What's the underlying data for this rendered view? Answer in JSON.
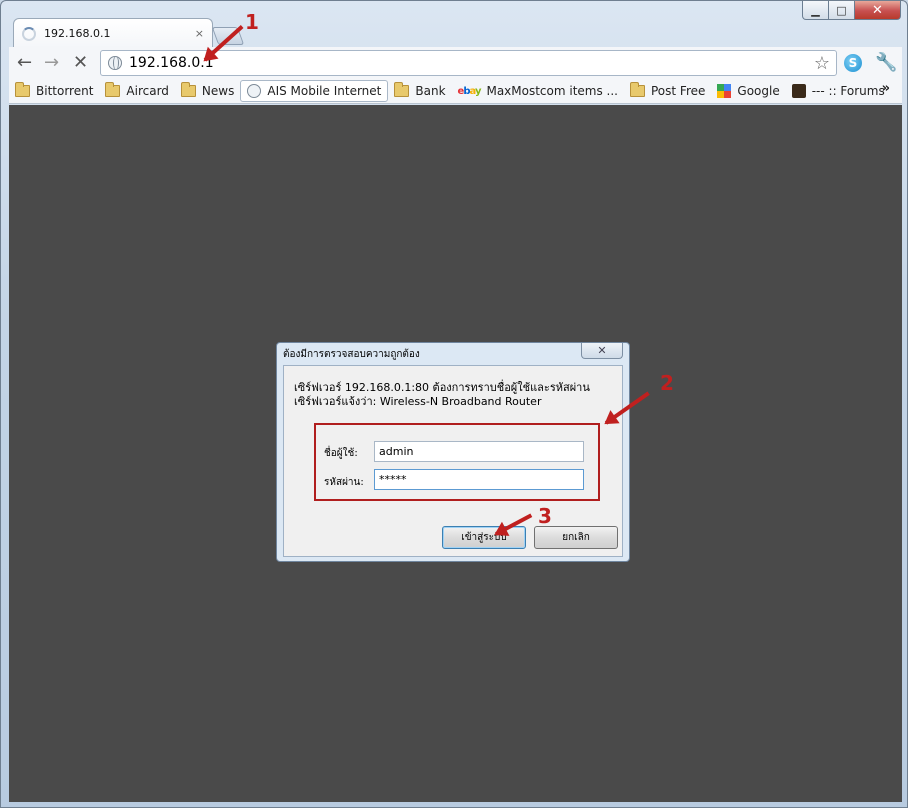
{
  "tab": {
    "title": "192.168.0.1",
    "close_glyph": "×"
  },
  "toolbar": {
    "url": "192.168.0.1"
  },
  "bookmarks": [
    {
      "label": "Bittorrent",
      "icon": "folder"
    },
    {
      "label": "Aircard",
      "icon": "folder"
    },
    {
      "label": "News",
      "icon": "folder"
    },
    {
      "label": "AIS Mobile Internet",
      "icon": "globe"
    },
    {
      "label": "Bank",
      "icon": "folder"
    },
    {
      "label": "MaxMostcom items ...",
      "icon": "ebay"
    },
    {
      "label": "Post Free",
      "icon": "folder"
    },
    {
      "label": "Google",
      "icon": "google"
    },
    {
      "label": "--- :: Forums",
      "icon": "forum"
    }
  ],
  "dialog": {
    "title": "ต้องมีการตรวจสอบความถูกต้อง",
    "message_line1": "เซิร์ฟเวอร์ 192.168.0.1:80 ต้องการทราบชื่อผู้ใช้และรหัสผ่าน",
    "message_line2": "เซิร์ฟเวอร์แจ้งว่า: Wireless-N Broadband Router",
    "username_label": "ชื่อผู้ใช้:",
    "username_value": "admin",
    "password_label": "รหัสผ่าน:",
    "password_value": "*****",
    "login_button": "เข้าสู่ระบบ",
    "cancel_button": "ยกเลิก"
  },
  "annotations": {
    "step1": "1",
    "step2": "2",
    "step3": "3"
  },
  "colors": {
    "annotation": "#c0201f",
    "content_bg": "#4a4a4a"
  }
}
